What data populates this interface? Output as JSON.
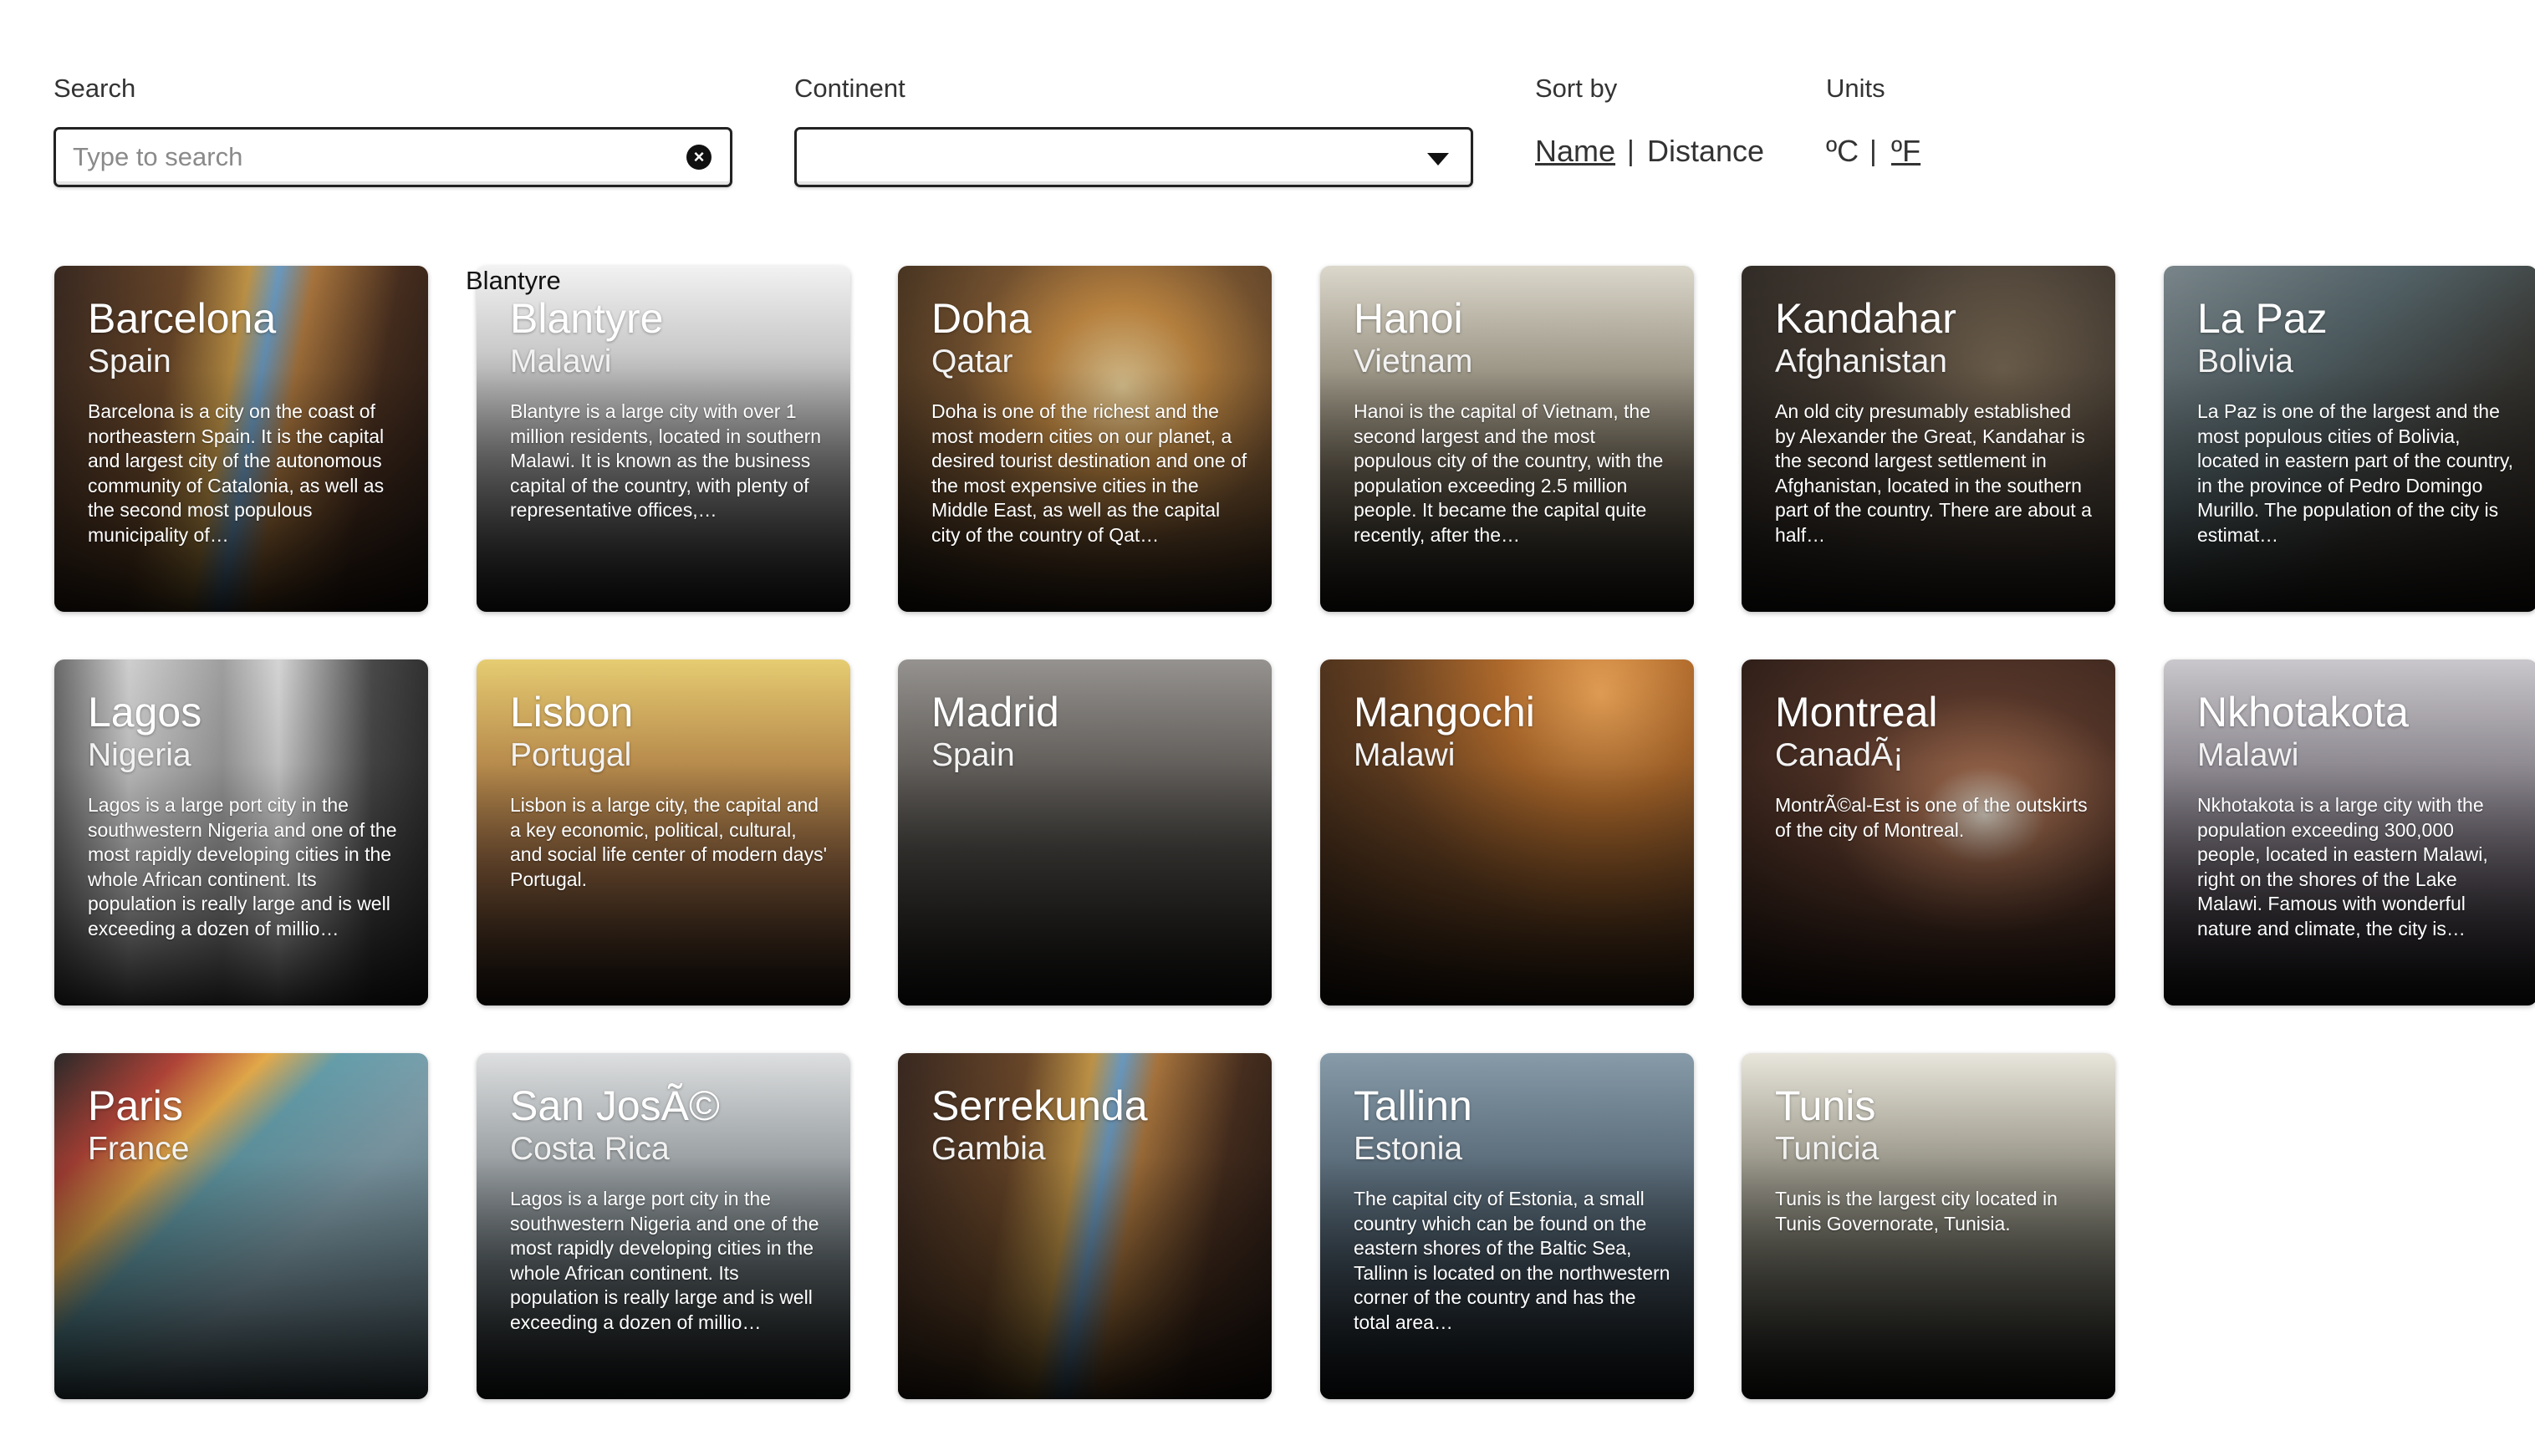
{
  "filters": {
    "search_label": "Search",
    "search_placeholder": "Type to search",
    "search_value": "",
    "clear_icon": "close-circle-icon",
    "continent_label": "Continent",
    "continent_value": "",
    "sort_label": "Sort by",
    "sort_options": [
      "Name",
      "Distance"
    ],
    "sort_separator": "|",
    "units_label": "Units",
    "units_options": [
      "ºC",
      "ºF"
    ],
    "units_separator": "|"
  },
  "hover_tooltip": "Blantyre",
  "cities": [
    {
      "name": "Barcelona",
      "country": "Spain",
      "description": "Barcelona is a city on the coast of northeastern Spain. It is the capital and largest city of the autonomous community of Catalonia, as well as the second most populous municipality of…"
    },
    {
      "name": "Blantyre",
      "country": "Malawi",
      "description": "Blantyre is a large city with over 1 million residents, located in southern Malawi. It is known as the business capital of the country, with plenty of representative offices,…"
    },
    {
      "name": "Doha",
      "country": "Qatar",
      "description": "Doha is one of the richest and the most modern cities on our planet, a desired tourist destination and one of the most expensive cities in the Middle East, as well as the capital city of the country of Qat…"
    },
    {
      "name": "Hanoi",
      "country": "Vietnam",
      "description": "Hanoi is the capital of Vietnam, the second largest and the most populous city of the country, with the population exceeding 2.5 million people. It became the capital quite recently, after the…"
    },
    {
      "name": "Kandahar",
      "country": "Afghanistan",
      "description": "An old city presumably established by Alexander the Great, Kandahar is the second largest settlement in Afghanistan, located in the southern part of the country. There are about a half…"
    },
    {
      "name": "La Paz",
      "country": "Bolivia",
      "description": "La Paz is one of the largest and the most populous cities of Bolivia, located in eastern part of the country, in the province of Pedro Domingo Murillo. The population of the city is estimat…"
    },
    {
      "name": "Lagos",
      "country": "Nigeria",
      "description": "Lagos is a large port city in the southwestern Nigeria and one of the most rapidly developing cities in the whole African continent. Its population is really large and is well exceeding a dozen of millio…"
    },
    {
      "name": "Lisbon",
      "country": "Portugal",
      "description": "Lisbon is a large city, the capital and a key economic, political, cultural, and social life center of modern days' Portugal."
    },
    {
      "name": "Madrid",
      "country": "Spain",
      "description": ""
    },
    {
      "name": "Mangochi",
      "country": "Malawi",
      "description": ""
    },
    {
      "name": "Montreal",
      "country": "CanadÃ¡",
      "description": "MontrÃ©al-Est is one of the outskirts of the city of Montreal."
    },
    {
      "name": "Nkhotakota",
      "country": "Malawi",
      "description": "Nkhotakota is a large city with the population exceeding 300,000 people, located in eastern Malawi, right on the shores of the Lake Malawi. Famous with wonderful nature and climate, the city is…"
    },
    {
      "name": "Paris",
      "country": "France",
      "description": ""
    },
    {
      "name": "San JosÃ©",
      "country": "Costa Rica",
      "description": "Lagos is a large port city in the southwestern Nigeria and one of the most rapidly developing cities in the whole African continent. Its population is really large and is well exceeding a dozen of millio…"
    },
    {
      "name": "Serrekunda",
      "country": "Gambia",
      "description": ""
    },
    {
      "name": "Tallinn",
      "country": "Estonia",
      "description": "The capital city of Estonia, a small country which can be found on the eastern shores of the Baltic Sea, Tallinn is located on the northwestern corner of the country and has the total area…"
    },
    {
      "name": "Tunis",
      "country": "Tunicia",
      "description": "Tunis is the largest city located in Tunis Governorate, Tunisia."
    }
  ]
}
